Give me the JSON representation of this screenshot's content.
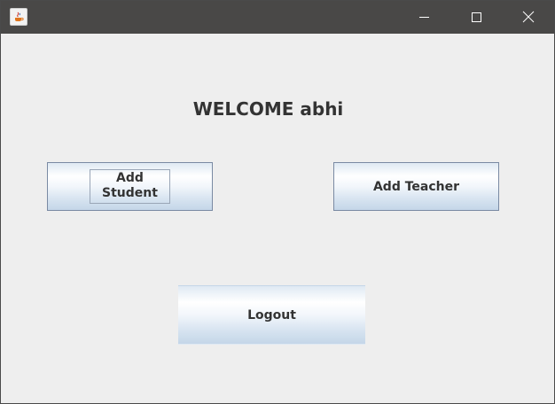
{
  "window": {
    "title": "",
    "controls": {
      "minimize_icon": "minimize-icon",
      "maximize_icon": "maximize-icon",
      "close_icon": "close-icon"
    }
  },
  "main": {
    "welcome_text": "WELCOME abhi",
    "buttons": {
      "add_student": "Add Student",
      "add_teacher": "Add Teacher",
      "logout": "Logout"
    }
  },
  "colors": {
    "titlebar": "#494847",
    "background": "#eeeeee",
    "text": "#333333",
    "button_border": "#7a8aa3"
  }
}
